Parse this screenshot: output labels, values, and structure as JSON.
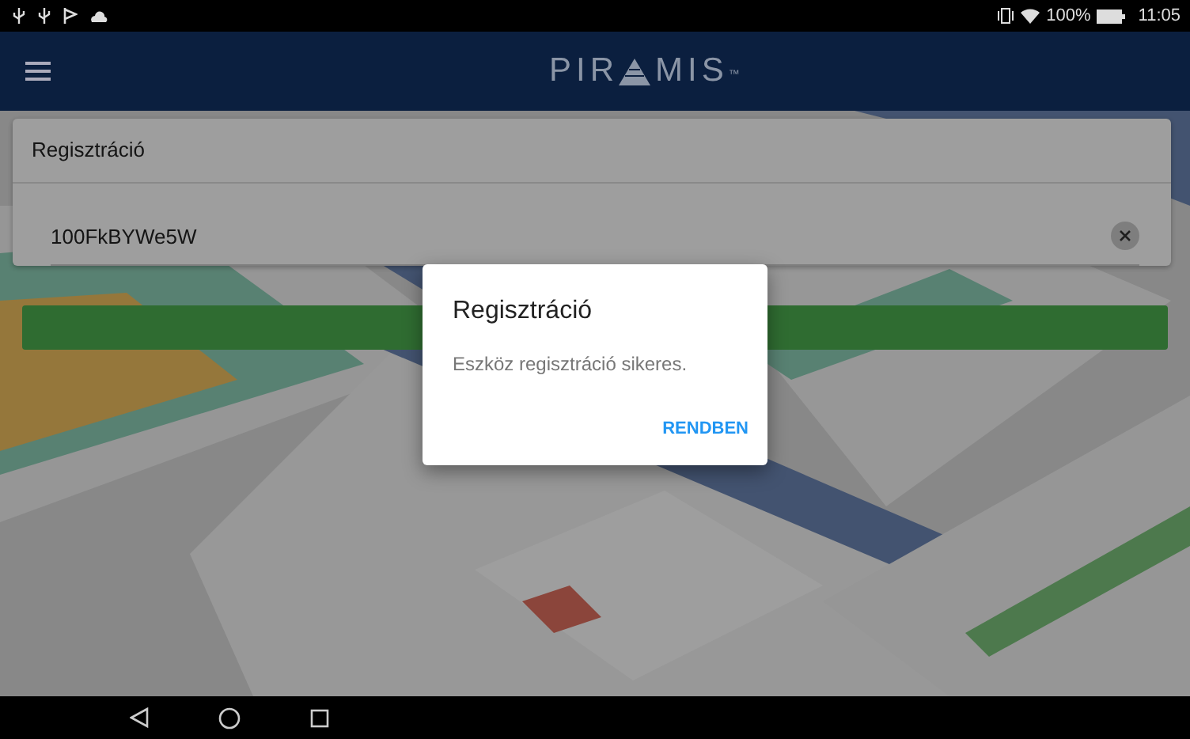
{
  "status_bar": {
    "battery": "100%",
    "time": "11:05"
  },
  "app_bar": {
    "logo": {
      "before": "PIR",
      "after": "MIS",
      "trademark": "™"
    }
  },
  "registration_card": {
    "title": "Regisztráció",
    "field": {
      "value": "100FkBYWe5W"
    }
  },
  "dialog": {
    "title": "Regisztráció",
    "message": "Eszköz regisztráció sikeres.",
    "buttons": [
      "RENDBEN"
    ]
  }
}
